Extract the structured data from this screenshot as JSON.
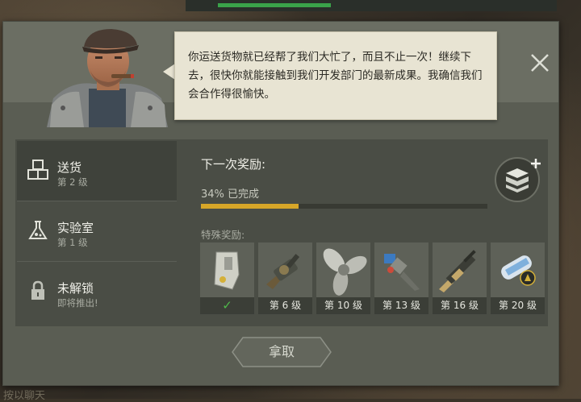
{
  "speech": {
    "text": "你运送货物就已经帮了我们大忙了，而且不止一次！继续下去，很快你就能接触到我们开发部门的最新成果。我确信我们会合作得很愉快。"
  },
  "sidebar": {
    "items": [
      {
        "title": "送货",
        "sub": "第 2 级",
        "icon": "boxes-icon"
      },
      {
        "title": "实验室",
        "sub": "第 1 级",
        "icon": "flask-icon"
      },
      {
        "title": "未解锁",
        "sub": "即将推出!",
        "icon": "lock-icon"
      }
    ]
  },
  "progress": {
    "next_label": "下一次奖励:",
    "status_text": "34% 已完成",
    "value": 0.34,
    "bar_color": "#d7a628"
  },
  "special": {
    "label": "特殊奖励:",
    "items": [
      {
        "name": "keycard",
        "level_label": "",
        "claimed": true
      },
      {
        "name": "grenade-launcher",
        "level_label": "第 6 级",
        "claimed": false
      },
      {
        "name": "propeller",
        "level_label": "第 10 级",
        "claimed": false
      },
      {
        "name": "drill",
        "level_label": "第 13 级",
        "claimed": false
      },
      {
        "name": "rifle",
        "level_label": "第 16 级",
        "claimed": false
      },
      {
        "name": "blueprint",
        "level_label": "第 20 级",
        "claimed": false
      }
    ]
  },
  "claim_button": {
    "label": "拿取"
  },
  "chat_hint": "按以聊天"
}
